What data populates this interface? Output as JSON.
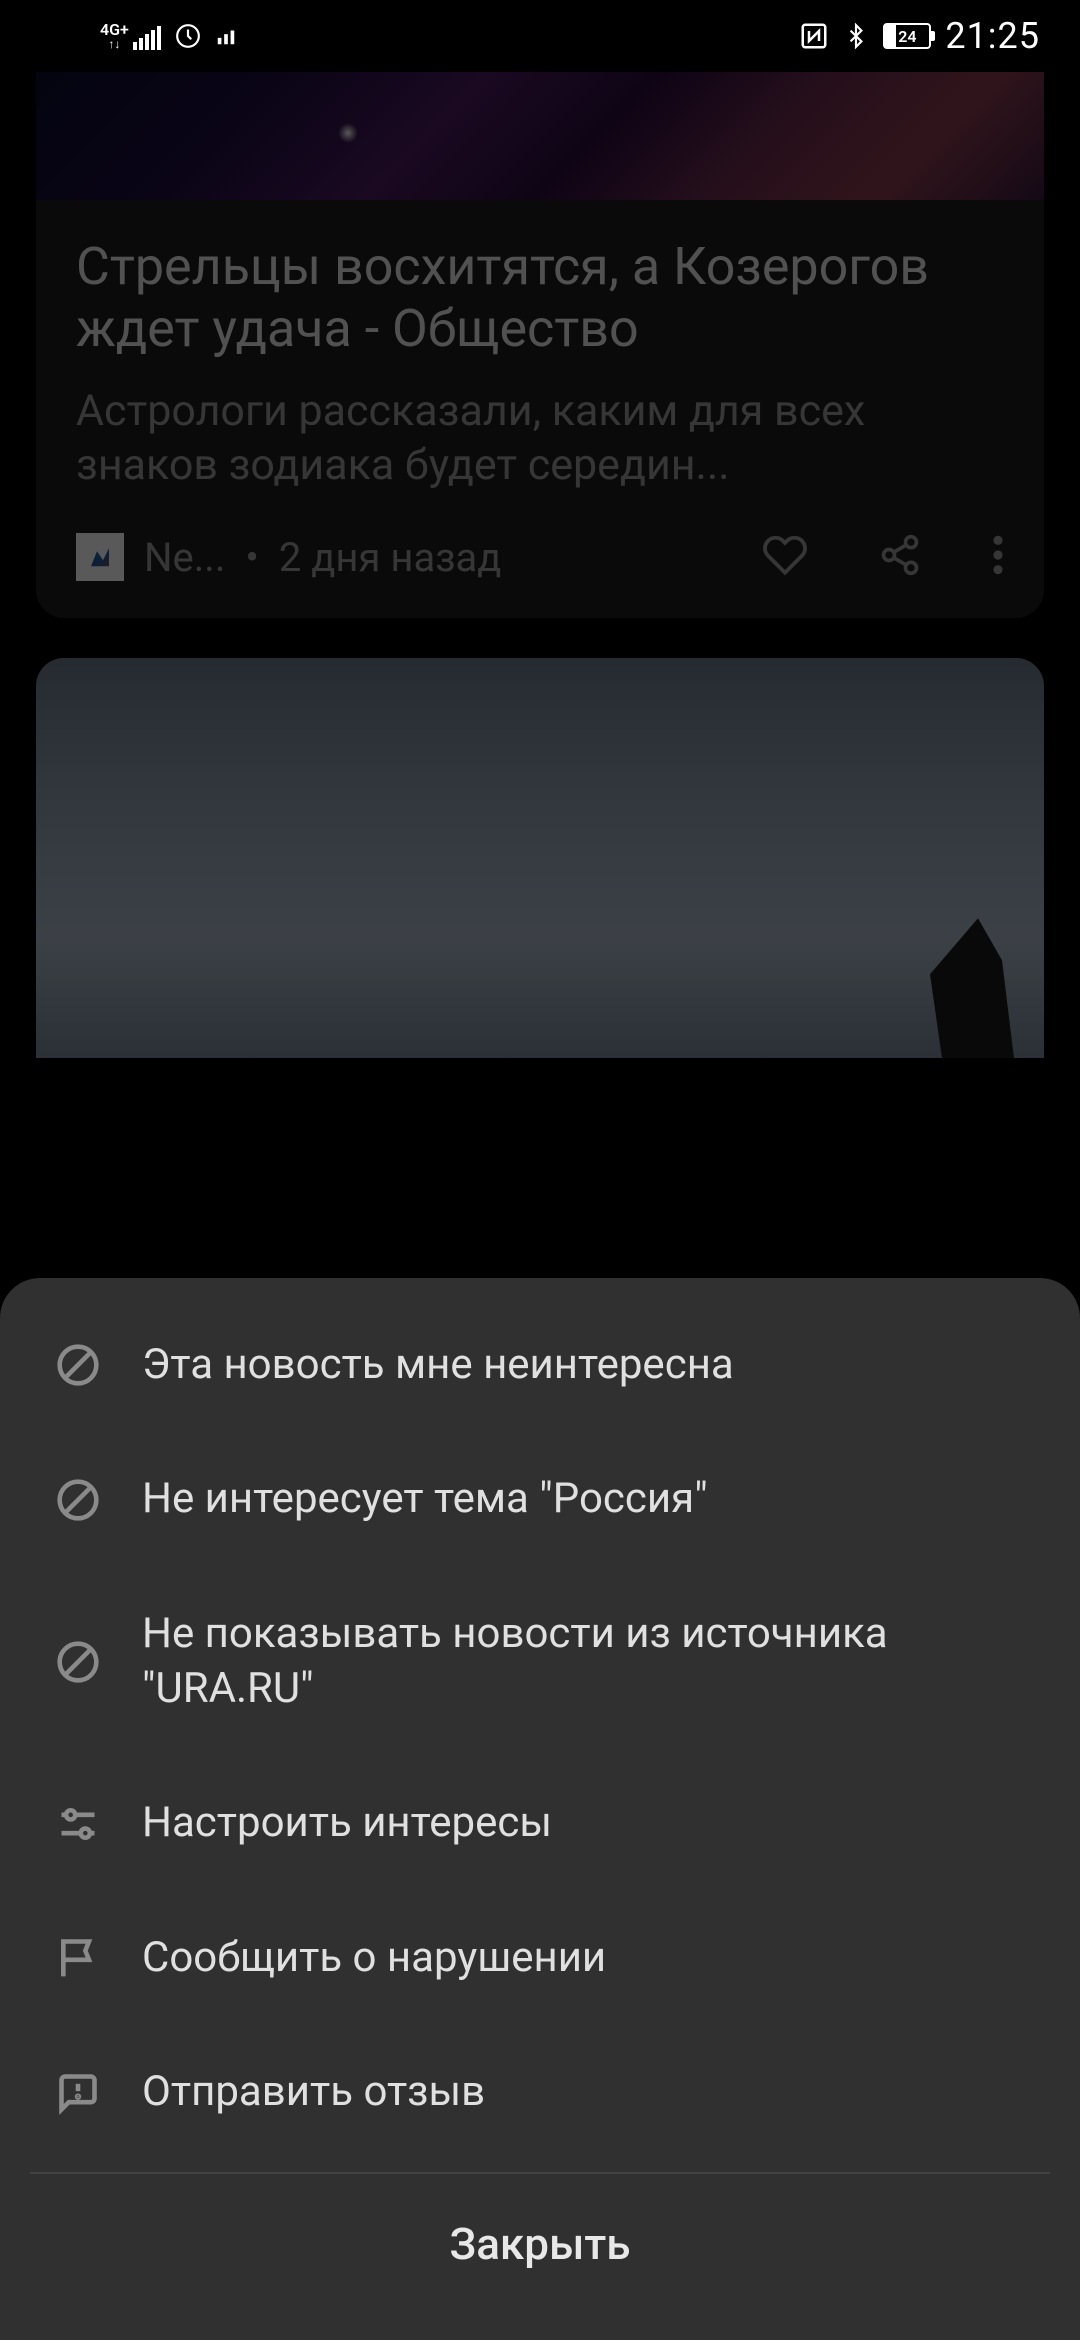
{
  "status": {
    "network": "4G+",
    "battery_pct": "24",
    "time": "21:25"
  },
  "card1": {
    "title": "Стрельцы восхитятся, а Козерогов ждет удача - Общество",
    "desc": "Астрологи рассказали, каким для всех знаков зодиака будет середин...",
    "source": "Ne...",
    "separator": "•",
    "time": "2 дня назад"
  },
  "sheet": {
    "items": [
      {
        "label": "Эта новость мне неинтересна"
      },
      {
        "label": "Не интересует тема \"Россия\""
      },
      {
        "label": "Не показывать новости из источника \"URA.RU\""
      },
      {
        "label": "Настроить интересы"
      },
      {
        "label": "Сообщить о нарушении"
      },
      {
        "label": "Отправить отзыв"
      }
    ],
    "close": "Закрыть"
  }
}
